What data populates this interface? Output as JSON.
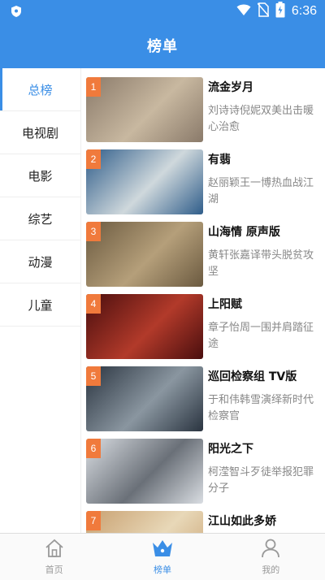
{
  "status": {
    "time": "6:36"
  },
  "header": {
    "title": "榜单"
  },
  "sidebar": {
    "items": [
      {
        "label": "总榜"
      },
      {
        "label": "电视剧"
      },
      {
        "label": "电影"
      },
      {
        "label": "综艺"
      },
      {
        "label": "动漫"
      },
      {
        "label": "儿童"
      }
    ]
  },
  "list": [
    {
      "rank": "1",
      "title": "流金岁月",
      "desc": "刘诗诗倪妮双美出击暖心治愈",
      "colors": [
        "#8a7a6a",
        "#c8b8a0"
      ]
    },
    {
      "rank": "2",
      "title": "有翡",
      "desc": "赵丽颖王一博热血战江湖",
      "colors": [
        "#2f5d8a",
        "#cfd8dc"
      ]
    },
    {
      "rank": "3",
      "title": "山海情 原声版",
      "desc": "黄轩张嘉译带头脱贫攻坚",
      "colors": [
        "#6b5a40",
        "#b59f7a"
      ]
    },
    {
      "rank": "4",
      "title": "上阳赋",
      "desc": "章子怡周一围并肩踏征途",
      "colors": [
        "#4a0e0e",
        "#b23a2a"
      ]
    },
    {
      "rank": "5",
      "title": "巡回检察组 TV版",
      "desc": "于和伟韩雪演绎新时代检察官",
      "colors": [
        "#2a3440",
        "#8a96a0"
      ]
    },
    {
      "rank": "6",
      "title": "阳光之下",
      "desc": "柯滢智斗歹徒举报犯罪分子",
      "colors": [
        "#d9dde2",
        "#6a7078"
      ]
    },
    {
      "rank": "7",
      "title": "江山如此多娇",
      "desc": "",
      "colors": [
        "#c8a070",
        "#e8d8b8"
      ]
    }
  ],
  "tabbar": {
    "items": [
      {
        "label": "首页"
      },
      {
        "label": "榜单"
      },
      {
        "label": "我的"
      }
    ]
  }
}
